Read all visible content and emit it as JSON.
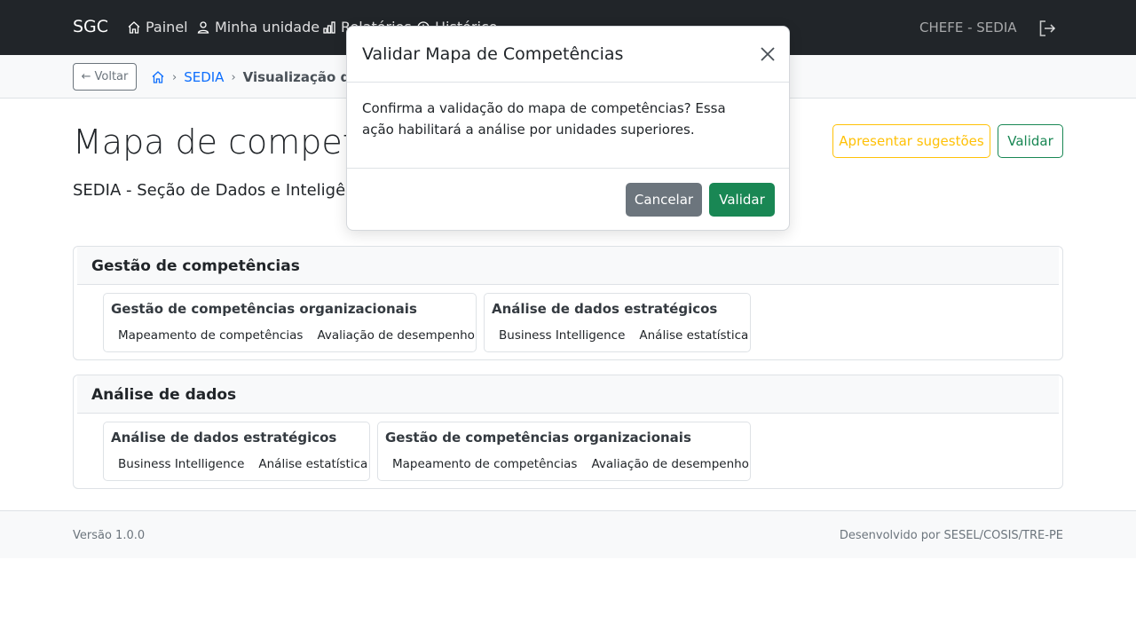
{
  "navbar": {
    "brand": "SGC",
    "items": [
      {
        "label": "Painel",
        "icon": "house-icon"
      },
      {
        "label": "Minha unidade",
        "icon": "person-icon"
      },
      {
        "label": "Relatórios",
        "icon": "bar-chart-icon"
      },
      {
        "label": "Histórico",
        "icon": "clock-icon"
      }
    ],
    "user": "CHEFE - SEDIA",
    "logout_icon": "logout-icon",
    "bg_color": "#212529"
  },
  "breadcrumb": {
    "back_label": "Voltar",
    "home_icon": "house-icon",
    "items": [
      "SEDIA",
      "Visualização de mapa"
    ]
  },
  "header": {
    "title": "Mapa de competências técnicas",
    "subtitle": "SEDIA - Seção de Dados e Inteligência Artificial",
    "suggest_label": "Apresentar sugestões",
    "validate_label": "Validar"
  },
  "competencies": [
    {
      "title": "Gestão de competências",
      "activities": [
        {
          "title": "Gestão de competências organizacionais",
          "knowledge": [
            "Mapeamento de competências",
            "Avaliação de desempenho"
          ]
        },
        {
          "title": "Análise de dados estratégicos",
          "knowledge": [
            "Business Intelligence",
            "Análise estatística"
          ]
        }
      ]
    },
    {
      "title": "Análise de dados",
      "activities": [
        {
          "title": "Análise de dados estratégicos",
          "knowledge": [
            "Business Intelligence",
            "Análise estatística"
          ]
        },
        {
          "title": "Gestão de competências organizacionais",
          "knowledge": [
            "Mapeamento de competências",
            "Avaliação de desempenho"
          ]
        }
      ]
    }
  ],
  "footer": {
    "version": "Versão 1.0.0",
    "developer": "Desenvolvido por SESEL/COSIS/TRE-PE"
  },
  "modal": {
    "title": "Validar Mapa de Competências",
    "body": "Confirma a validação do mapa de competências? Essa ação habilitará a análise por unidades superiores.",
    "cancel_label": "Cancelar",
    "confirm_label": "Validar"
  },
  "colors": {
    "primary": "#0d6efd",
    "success": "#198754",
    "warning": "#ffc107",
    "secondary": "#6c757d"
  }
}
